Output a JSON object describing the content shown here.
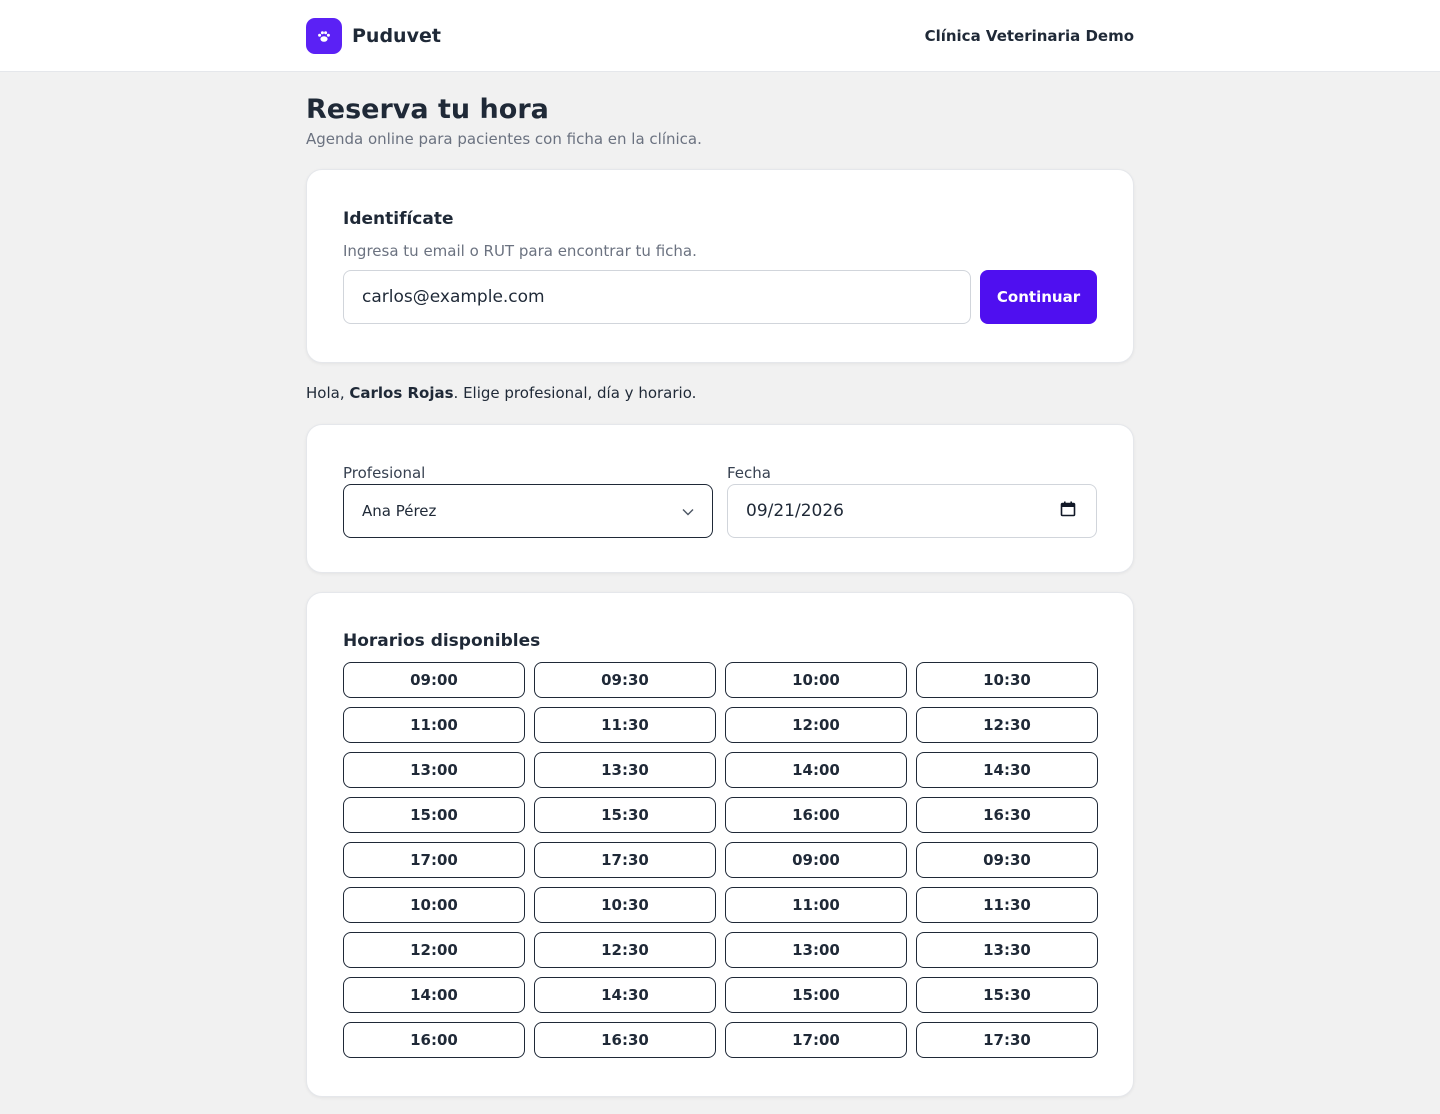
{
  "header": {
    "brand": "Puduvet",
    "clinic": "Clínica Veterinaria Demo",
    "logo_icon": "paw-icon",
    "accent_color": "#5b21f5"
  },
  "page": {
    "title": "Reserva tu hora",
    "subtitle": "Agenda online para pacientes con ficha en la clínica."
  },
  "identify": {
    "title": "Identifícate",
    "hint": "Ingresa tu email o RUT para encontrar tu ficha.",
    "input_value": "carlos@example.com",
    "button_label": "Continuar"
  },
  "greeting": {
    "prefix": "Hola, ",
    "name": "Carlos Rojas",
    "suffix": ". Elige profesional, día y horario."
  },
  "selection": {
    "professional_label": "Profesional",
    "professional_value": "Ana Pérez",
    "date_label": "Fecha",
    "date_value": "09/21/2026"
  },
  "slots": {
    "title": "Horarios disponibles",
    "times": [
      "09:00",
      "09:30",
      "10:00",
      "10:30",
      "11:00",
      "11:30",
      "12:00",
      "12:30",
      "13:00",
      "13:30",
      "14:00",
      "14:30",
      "15:00",
      "15:30",
      "16:00",
      "16:30",
      "17:00",
      "17:30",
      "09:00",
      "09:30",
      "10:00",
      "10:30",
      "11:00",
      "11:30",
      "12:00",
      "12:30",
      "13:00",
      "13:30",
      "14:00",
      "14:30",
      "15:00",
      "15:30",
      "16:00",
      "16:30",
      "17:00",
      "17:30"
    ]
  }
}
